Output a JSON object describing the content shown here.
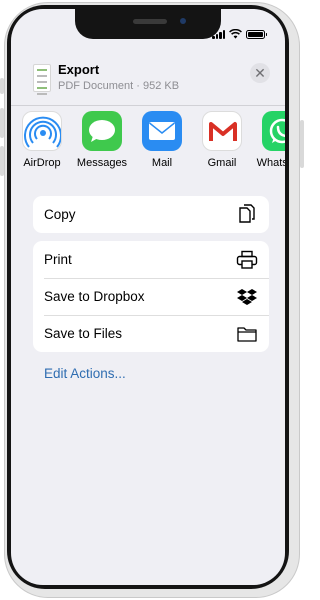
{
  "status_bar": {
    "time": ""
  },
  "header": {
    "title": "Export",
    "subtitle": "PDF Document · 952 KB",
    "close_symbol": "✕"
  },
  "apps": [
    {
      "label": "AirDrop",
      "icon": "airdrop-icon"
    },
    {
      "label": "Messages",
      "icon": "messages-icon"
    },
    {
      "label": "Mail",
      "icon": "mail-icon"
    },
    {
      "label": "Gmail",
      "icon": "gmail-icon"
    },
    {
      "label": "WhatsApp",
      "icon": "whatsapp-icon"
    }
  ],
  "actions_group1": [
    {
      "label": "Copy",
      "icon": "copy-icon"
    }
  ],
  "actions_group2": [
    {
      "label": "Print",
      "icon": "print-icon"
    },
    {
      "label": "Save to Dropbox",
      "icon": "dropbox-icon"
    },
    {
      "label": "Save to Files",
      "icon": "folder-icon"
    }
  ],
  "edit_actions": "Edit Actions...",
  "colors": {
    "link": "#2f6db1",
    "sheet_background": "#efeff4",
    "messages_green": "#3fc94d",
    "mail_blue": "#2a8cf2",
    "whatsapp_green": "#25d366"
  }
}
